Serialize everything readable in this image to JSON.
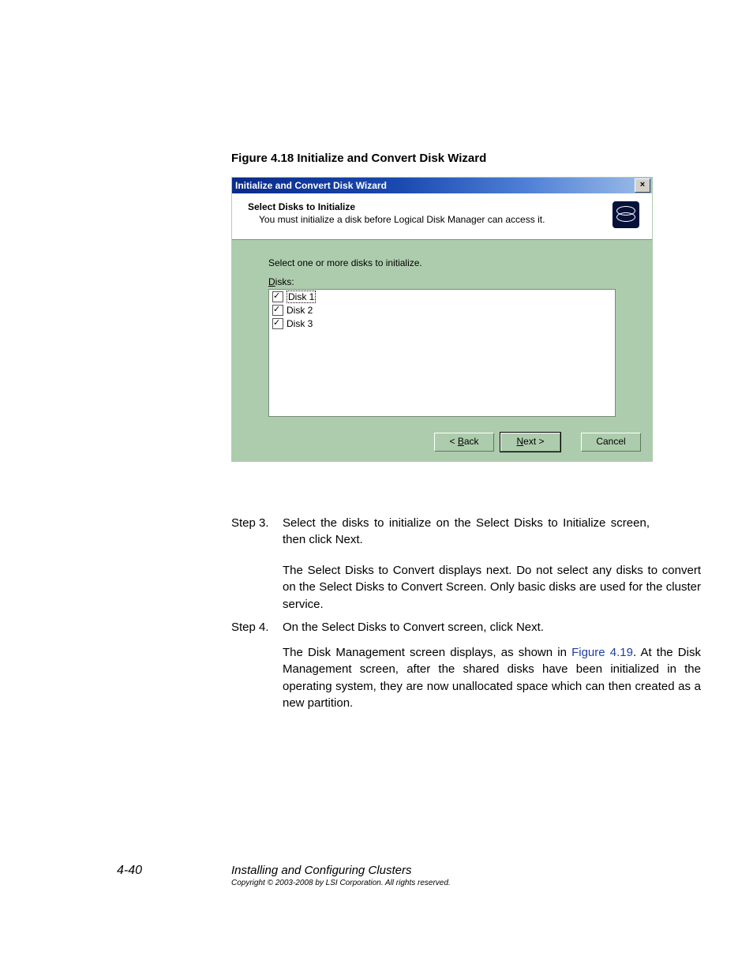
{
  "figure_caption": "Figure 4.18   Initialize and Convert Disk Wizard",
  "wizard": {
    "title": "Initialize and Convert Disk Wizard",
    "close_glyph": "×",
    "header_title": "Select Disks to Initialize",
    "header_sub": "You must initialize a disk before Logical Disk Manager can access it.",
    "instruction": "Select one or more disks to initialize.",
    "list_label_prefix": "D",
    "list_label_rest": "isks:",
    "disks": [
      {
        "label": "Disk 1",
        "checked": true,
        "selected": true
      },
      {
        "label": "Disk 2",
        "checked": true,
        "selected": false
      },
      {
        "label": "Disk 3",
        "checked": true,
        "selected": false
      }
    ],
    "buttons": {
      "back_prefix": "< ",
      "back_ul": "B",
      "back_rest": "ack",
      "next_ul": "N",
      "next_rest": "ext >",
      "cancel": "Cancel"
    }
  },
  "steps": {
    "s3_label": "Step 3.",
    "s3_text": "Select the disks to initialize on the Select Disks to Initialize screen, then click Next.",
    "s3_p2": "The Select Disks to Convert displays next. Do not select any disks to convert on the Select Disks to Convert Screen. Only basic disks are used for the cluster service.",
    "s4_label": "Step 4.",
    "s4_text": "On the Select Disks to Convert screen, click Next.",
    "s4_p2_a": "The Disk Management screen displays, as shown in ",
    "s4_link": "Figure 4.19",
    "s4_p2_b": ". At the Disk Management screen, after the shared disks have been initialized in the operating system, they are now unallocated space which can then created as a new partition."
  },
  "footer": {
    "page_num": "4-40",
    "title": "Installing and Configuring Clusters",
    "copyright": "Copyright © 2003-2008 by LSI Corporation. All rights reserved."
  }
}
